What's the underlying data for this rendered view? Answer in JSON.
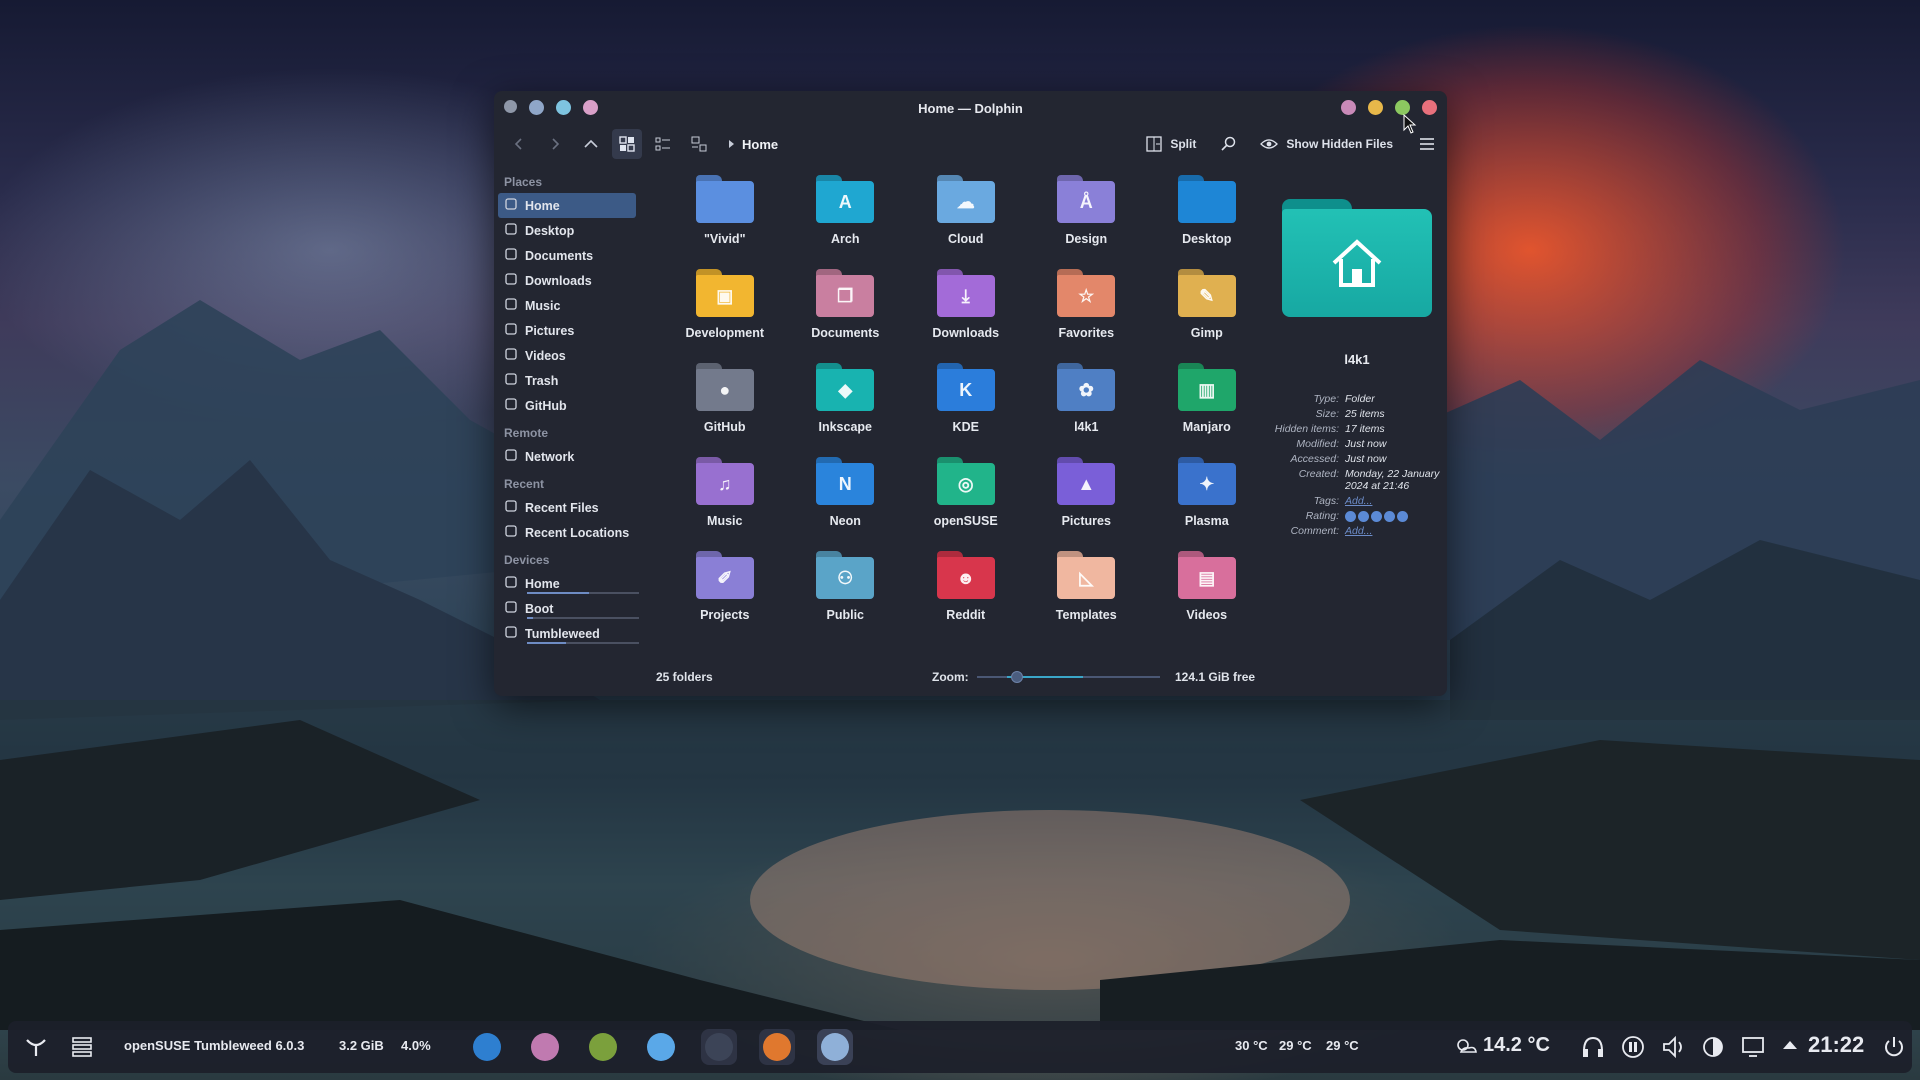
{
  "window": {
    "title": "Home — Dolphin",
    "breadcrumb": "Home",
    "split_label": "Split",
    "hidden_files_label": "Show Hidden Files"
  },
  "places": {
    "sections": {
      "places": "Places",
      "remote": "Remote",
      "recent": "Recent",
      "devices": "Devices"
    },
    "items": [
      {
        "label": "Home",
        "icon": "home-icon",
        "selected": true
      },
      {
        "label": "Desktop",
        "icon": "desktop-icon"
      },
      {
        "label": "Documents",
        "icon": "documents-icon"
      },
      {
        "label": "Downloads",
        "icon": "downloads-icon"
      },
      {
        "label": "Music",
        "icon": "music-icon"
      },
      {
        "label": "Pictures",
        "icon": "pictures-icon"
      },
      {
        "label": "Videos",
        "icon": "videos-icon"
      },
      {
        "label": "Trash",
        "icon": "trash-icon"
      },
      {
        "label": "GitHub",
        "icon": "github-icon"
      }
    ],
    "remote": [
      {
        "label": "Network",
        "icon": "network-icon"
      }
    ],
    "recent": [
      {
        "label": "Recent Files",
        "icon": "recent-files-icon"
      },
      {
        "label": "Recent Locations",
        "icon": "recent-locations-icon"
      }
    ],
    "devices": [
      {
        "label": "Home",
        "usage": 0.55
      },
      {
        "label": "Boot",
        "usage": 0.05
      },
      {
        "label": "Tumbleweed",
        "usage": 0.35
      }
    ]
  },
  "folders": [
    {
      "name": "\"Vivid\"",
      "color": "#5b8fe0",
      "glyph": ""
    },
    {
      "name": "Arch",
      "color": "#1fa7d1",
      "glyph": "A"
    },
    {
      "name": "Cloud",
      "color": "#6aa9e0",
      "glyph": "☁"
    },
    {
      "name": "Design",
      "color": "#8a80d8",
      "glyph": "Å"
    },
    {
      "name": "Desktop",
      "color": "#1e86d6",
      "glyph": ""
    },
    {
      "name": "Development",
      "color": "#f2b630",
      "glyph": "▣"
    },
    {
      "name": "Documents",
      "color": "#c97fa0",
      "glyph": "❐"
    },
    {
      "name": "Downloads",
      "color": "#a36bd8",
      "glyph": "⤓"
    },
    {
      "name": "Favorites",
      "color": "#e3876a",
      "glyph": "☆"
    },
    {
      "name": "Gimp",
      "color": "#e0b050",
      "glyph": "✎"
    },
    {
      "name": "GitHub",
      "color": "#737a8c",
      "glyph": "●"
    },
    {
      "name": "Inkscape",
      "color": "#18b3b0",
      "glyph": "◆"
    },
    {
      "name": "KDE",
      "color": "#2b7ddb",
      "glyph": "K"
    },
    {
      "name": "l4k1",
      "color": "#4f7fc4",
      "glyph": "✿"
    },
    {
      "name": "Manjaro",
      "color": "#1fa66a",
      "glyph": "▥"
    },
    {
      "name": "Music",
      "color": "#9870d0",
      "glyph": "♫"
    },
    {
      "name": "Neon",
      "color": "#2a84dc",
      "glyph": "N"
    },
    {
      "name": "openSUSE",
      "color": "#21b48a",
      "glyph": "◎"
    },
    {
      "name": "Pictures",
      "color": "#7a5fd8",
      "glyph": "▲"
    },
    {
      "name": "Plasma",
      "color": "#3a72cc",
      "glyph": "✦"
    },
    {
      "name": "Projects",
      "color": "#8a7fd6",
      "glyph": "✐"
    },
    {
      "name": "Public",
      "color": "#5aa4c8",
      "glyph": "⚇"
    },
    {
      "name": "Reddit",
      "color": "#d8364c",
      "glyph": "☻"
    },
    {
      "name": "Templates",
      "color": "#f0b7a0",
      "glyph": "◺"
    },
    {
      "name": "Videos",
      "color": "#d86f9c",
      "glyph": "▤"
    }
  ],
  "info_panel": {
    "name": "l4k1",
    "rows": [
      {
        "key": "Type:",
        "value": "Folder"
      },
      {
        "key": "Size:",
        "value": "25 items"
      },
      {
        "key": "Hidden items:",
        "value": "17 items"
      },
      {
        "key": "Modified:",
        "value": "Just now"
      },
      {
        "key": "Accessed:",
        "value": "Just now"
      },
      {
        "key": "Created:",
        "value": "Monday, 22 January 2024 at 21:46"
      }
    ],
    "tags_label": "Tags:",
    "tags_value": "Add...",
    "rating_label": "Rating:",
    "rating": 5,
    "comment_label": "Comment:",
    "comment_value": "Add..."
  },
  "status": {
    "count": "25 folders",
    "zoom_label": "Zoom:",
    "zoom_level": 0.2,
    "free_space": "124.1 GiB free"
  },
  "taskbar": {
    "distro": "openSUSE Tumbleweed 6.0.3",
    "memory": "3.2 GiB",
    "cpu": "4.0%",
    "temps": [
      "30 °C",
      "29 °C",
      "29 °C"
    ],
    "weather": "14.2 °C",
    "clock": "21:22"
  }
}
